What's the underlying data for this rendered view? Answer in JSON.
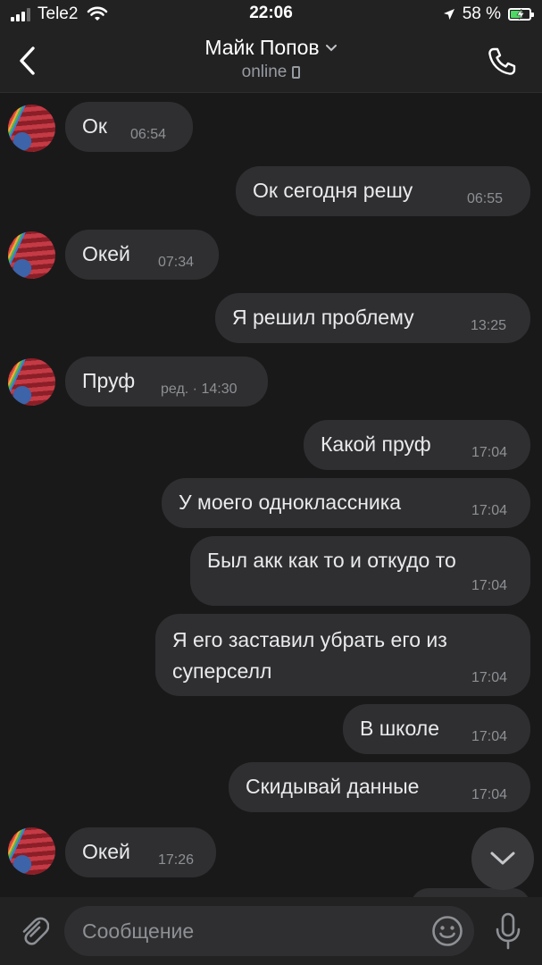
{
  "status_bar": {
    "carrier": "Tele2",
    "time": "22:06",
    "battery": "58 %",
    "battery_level": 0.58
  },
  "header": {
    "name": "Майк Попов",
    "status": "online"
  },
  "messages": [
    {
      "dir": "in",
      "text": "Ок",
      "time": "06:54"
    },
    {
      "dir": "out",
      "text": "Ок сегодня решу",
      "time": "06:55"
    },
    {
      "dir": "in",
      "text": "Окей",
      "time": "07:34"
    },
    {
      "dir": "out",
      "text": "Я решил проблему",
      "time": "13:25"
    },
    {
      "dir": "in",
      "text": "Пруф",
      "time": "ред. · 14:30"
    },
    {
      "dir": "out",
      "text": "Какой пруф",
      "time": "17:04"
    },
    {
      "dir": "out",
      "text": "У моего одноклассника",
      "time": "17:04"
    },
    {
      "dir": "out",
      "text": "Был акк как то и откудо то",
      "time": "17:04"
    },
    {
      "dir": "out",
      "lines": [
        "Я его заставил убрать его из",
        "суперселл"
      ],
      "time": "17:04"
    },
    {
      "dir": "out",
      "text": "В школе",
      "time": "17:04"
    },
    {
      "dir": "out",
      "text": "Скидывай данные",
      "time": "17:04"
    },
    {
      "dir": "in",
      "text": "Окей",
      "time": "17:26"
    }
  ],
  "composer": {
    "placeholder": "Сообщение"
  },
  "icons": {
    "back": "chevron-left-icon",
    "title_dropdown": "chevron-down-icon",
    "call": "phone-icon",
    "attach": "paperclip-icon",
    "emoji": "smile-icon",
    "mic": "microphone-icon",
    "scroll_down": "chevron-down-icon"
  },
  "colors": {
    "background": "#19191a",
    "bubble": "#2f2f31",
    "bar": "#222223",
    "battery_fill": "#4cd964"
  }
}
